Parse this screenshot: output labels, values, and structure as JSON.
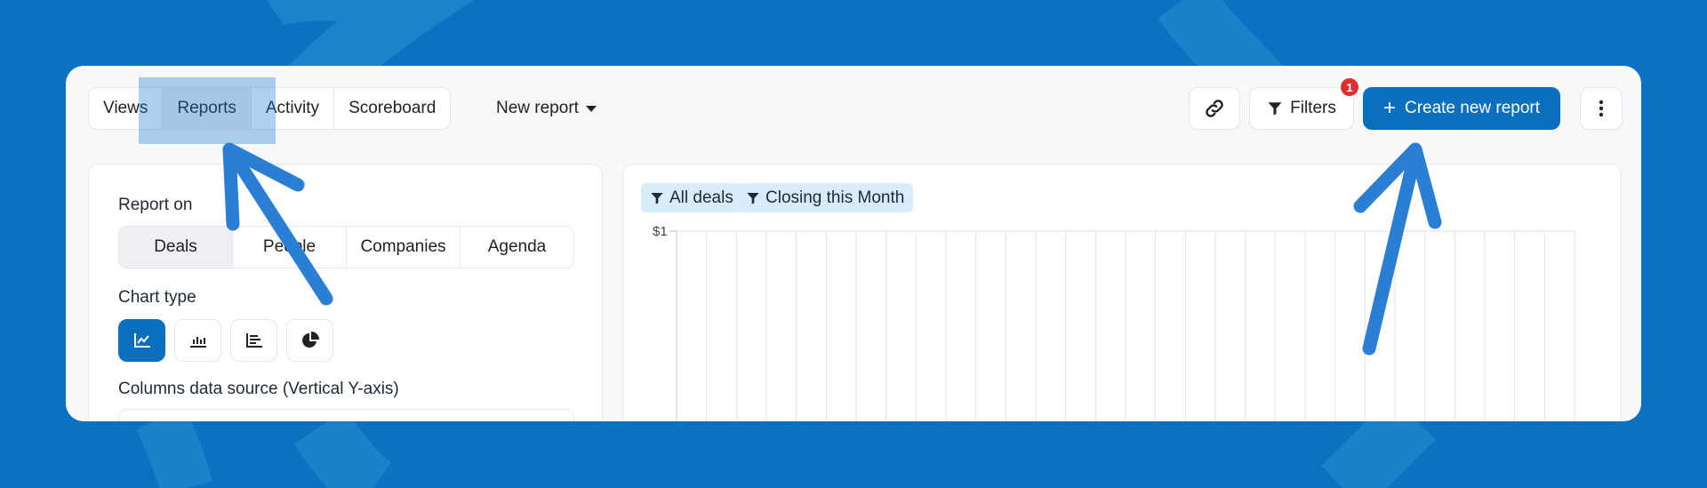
{
  "toolbar": {
    "tabs": [
      {
        "label": "Views"
      },
      {
        "label": "Reports"
      },
      {
        "label": "Activity"
      },
      {
        "label": "Scoreboard"
      }
    ],
    "new_report_label": "New report",
    "filters_label": "Filters",
    "filters_badge": "1",
    "create_label": "Create new report",
    "create_plus": "+"
  },
  "left_panel": {
    "report_on_label": "Report on",
    "report_on_options": [
      "Deals",
      "People",
      "Companies",
      "Agenda"
    ],
    "report_on_selected": "Deals",
    "chart_type_label": "Chart type",
    "chart_types": [
      "line-chart-icon",
      "bar-chart-icon",
      "horizontal-bar-chart-icon",
      "pie-chart-icon"
    ],
    "chart_type_selected": "line-chart-icon",
    "columns_source_label": "Columns data source (Vertical Y-axis)"
  },
  "right_panel": {
    "filter_chips": [
      "All deals",
      "Closing this Month"
    ],
    "y_tick_label": "$1"
  },
  "colors": {
    "background": "#0a72c0",
    "primary": "#0a6fbe",
    "chip": "#d8ecfa",
    "badge": "#dc2f2f",
    "annotation_arrow": "#2a7fd4"
  }
}
